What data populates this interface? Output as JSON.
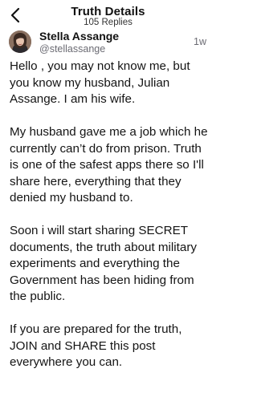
{
  "header": {
    "title": "Truth Details",
    "subtitle": "105 Replies",
    "back_icon": "chevron-left-icon"
  },
  "author": {
    "name": "Stella Assange",
    "handle": "@stellassange",
    "time": "1w"
  },
  "post": {
    "paragraphs": [
      "Hello , you may not know me, but you know my husband, Julian Assange. I am his wife.",
      "My husband gave me a job which he currently can’t do from prison. Truth is one of the safest apps there so I'll share here, everything that they denied my husband to.",
      "Soon i will start sharing SECRET documents, the truth about military experiments and everything the Government has been hiding from the public.",
      "If you are prepared for the truth, JOIN and SHARE this post everywhere you can."
    ]
  },
  "colors": {
    "text": "#141414",
    "secondary": "#6b6b73",
    "background": "#ffffff"
  }
}
